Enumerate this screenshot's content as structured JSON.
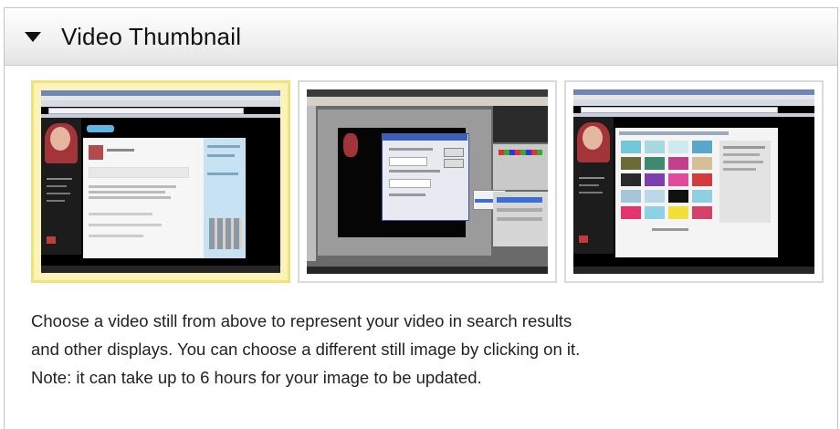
{
  "panel": {
    "title": "Video Thumbnail",
    "expanded": true
  },
  "thumbnails": [
    {
      "selected": true
    },
    {
      "selected": false
    },
    {
      "selected": false
    }
  ],
  "description": {
    "line1": "Choose a video still from above to represent your video in search results",
    "line2": "and other displays. You can choose a different still image by clicking on it.",
    "line3": "Note: it can take up to 6 hours for your image to be updated."
  },
  "colors": {
    "selected_border": "#f1e27a",
    "selected_fill": "#fbf3b8",
    "header_gradient_bottom": "#e3e3e3"
  }
}
